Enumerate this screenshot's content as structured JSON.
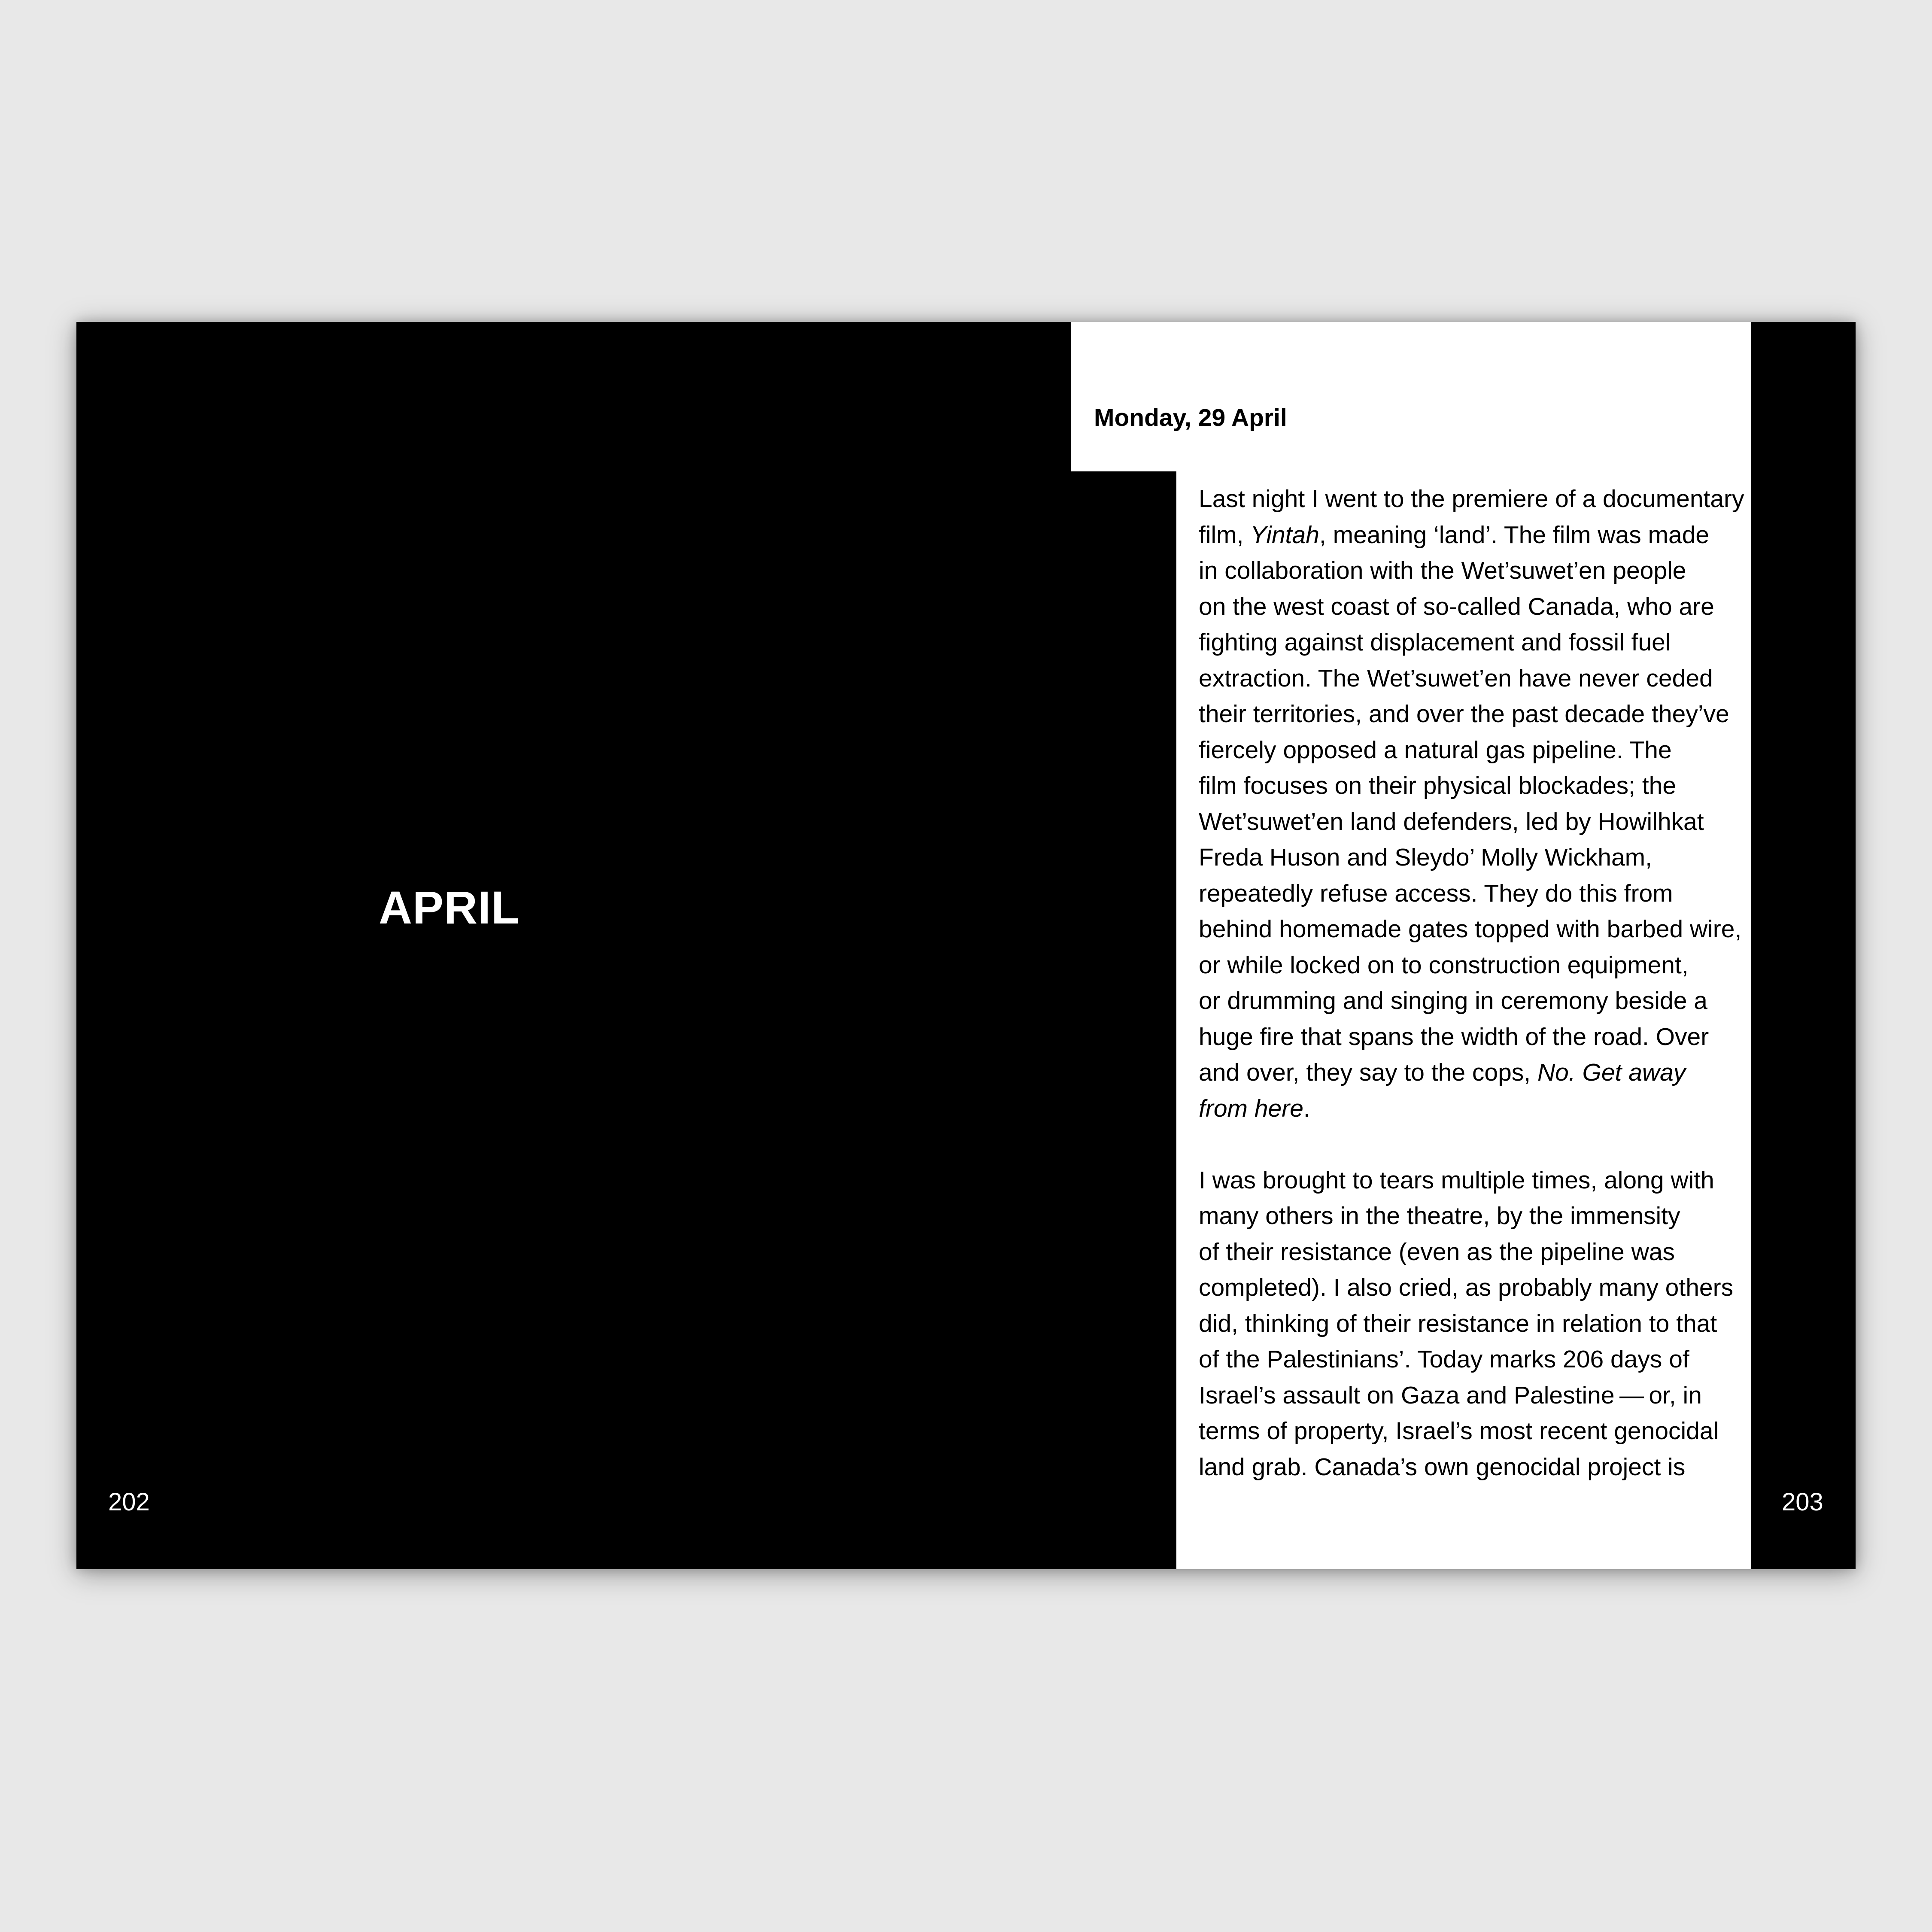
{
  "left_page": {
    "chapter_title": "APRIL",
    "page_number": "202"
  },
  "right_page": {
    "page_number": "203",
    "entry_date": "Monday, 29 April",
    "paragraph_1": [
      [
        "Last night I went to the premiere of a documentary"
      ],
      [
        "film, ",
        {
          "i": "Yintah"
        },
        ", meaning ‘land’. The film was made"
      ],
      [
        "in collaboration with the Wet’suwet’en people"
      ],
      [
        "on the west coast of so-called Canada, who are"
      ],
      [
        "fighting against displacement and fossil fuel"
      ],
      [
        "extraction. The Wet’suwet’en have never ceded"
      ],
      [
        "their territories, and over the past decade they’ve"
      ],
      [
        "fiercely opposed a natural gas pipeline. The"
      ],
      [
        "film focuses on their physical blockades; the"
      ],
      [
        "Wet’suwet’en land defenders, led by Howilhkat"
      ],
      [
        "Freda Huson and Sleydo’ Molly Wickham,"
      ],
      [
        "repeatedly refuse access. They do this from"
      ],
      [
        "behind homemade gates topped with barbed wire,"
      ],
      [
        "or while locked on to construction equipment,"
      ],
      [
        "or drumming and singing in ceremony beside a"
      ],
      [
        "huge fire that spans the width of the road. Over"
      ],
      [
        "and over, they say to the cops, ",
        {
          "i": "No. Get away"
        }
      ],
      [
        {
          "i": "from here"
        },
        "."
      ]
    ],
    "paragraph_2": [
      [
        "I was brought to tears multiple times, along with"
      ],
      [
        "many others in the theatre, by the immensity"
      ],
      [
        "of their resistance (even as the pipeline was"
      ],
      [
        "completed). I also cried, as probably many others"
      ],
      [
        "did, thinking of their resistance in relation to that"
      ],
      [
        "of the Palestinians’. Today marks 206 days of"
      ],
      [
        "Israel’s assault on Gaza and Palestine — or, in"
      ],
      [
        "terms of property, Israel’s most recent genocidal"
      ],
      [
        "land grab. Canada’s own genocidal project is"
      ]
    ]
  }
}
